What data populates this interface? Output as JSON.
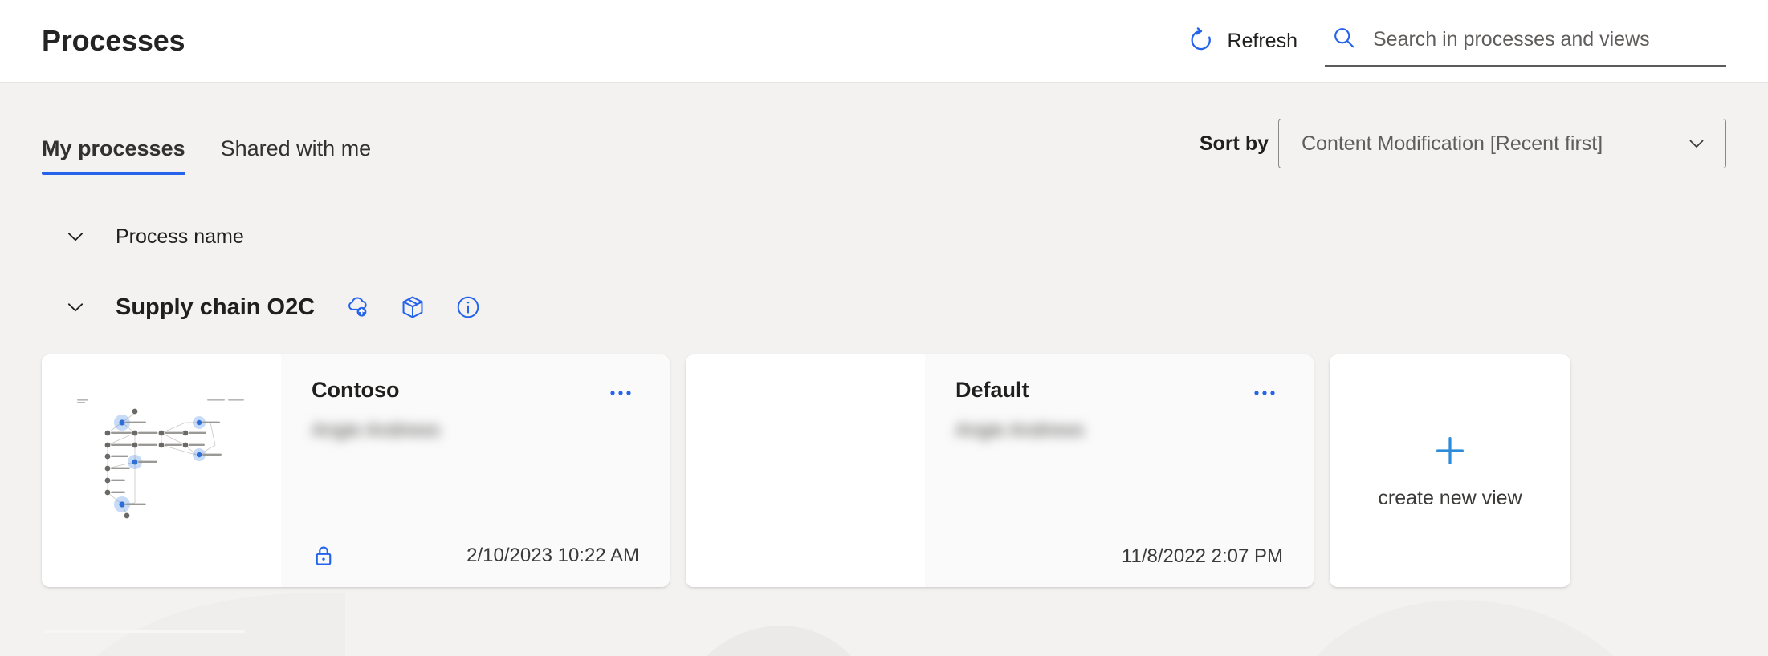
{
  "header": {
    "title": "Processes",
    "refresh_label": "Refresh",
    "refresh_icon": "refresh-circular-arrow-icon",
    "search_icon": "search-icon",
    "search_placeholder": "Search in processes and views",
    "search_value": ""
  },
  "subbar": {
    "tabs": [
      {
        "label": "My processes",
        "active": true
      },
      {
        "label": "Shared with me",
        "active": false
      }
    ],
    "sort": {
      "label": "Sort by",
      "value": "Content Modification [Recent first]",
      "chevron_icon": "chevron-down-icon"
    }
  },
  "list": {
    "column_header": "Process name",
    "column_chevron_icon": "chevron-down-icon",
    "process": {
      "name": "Supply chain O2C",
      "chevron_icon": "chevron-down-icon",
      "actions": [
        {
          "icon": "cloud-upload-icon"
        },
        {
          "icon": "package-box-icon"
        },
        {
          "icon": "info-circle-icon"
        }
      ]
    },
    "cards": [
      {
        "title": "Contoso",
        "author": "Angie Andrews",
        "date": "2/10/2023 10:22 AM",
        "locked": true,
        "lock_icon": "lock-closed-icon",
        "menu_icon": "more-options-icon",
        "has_thumbnail": true,
        "thumbnail_icon": "process-graph-thumbnail"
      },
      {
        "title": "Default",
        "author": "Angie Andrews",
        "date": "11/8/2022 2:07 PM",
        "locked": false,
        "lock_icon": "",
        "menu_icon": "more-options-icon",
        "has_thumbnail": false,
        "thumbnail_icon": ""
      }
    ],
    "create_card": {
      "label": "create new view",
      "icon": "plus-icon"
    }
  },
  "colors": {
    "accent_blue": "#2563eb",
    "tab_underline": "#2563eb",
    "plus_blue": "#2e8bd8",
    "page_background": "#f3f2f0",
    "header_background": "#ffffff",
    "card_background": "#ffffff",
    "card_body_background": "#fafafa"
  }
}
